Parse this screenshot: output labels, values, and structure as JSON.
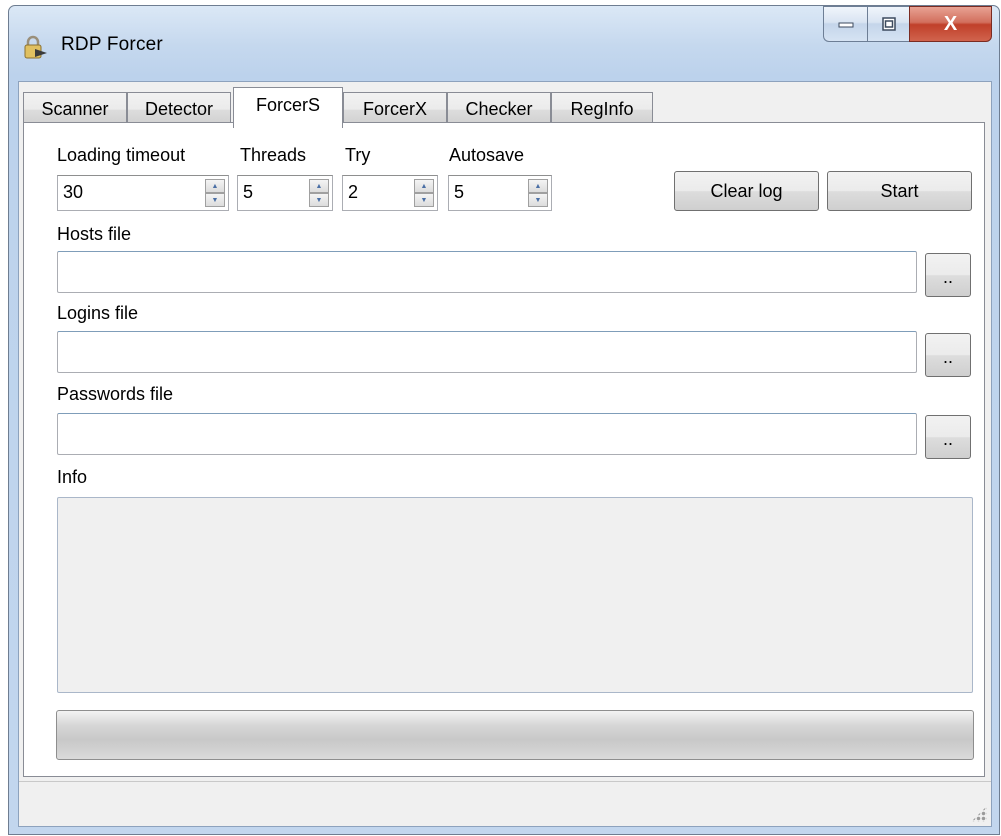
{
  "window": {
    "title": "RDP Forcer",
    "icon": "padlock-arrow-icon",
    "close_glyph": "X",
    "colors": {
      "close_red": "#c0402a",
      "frame_blue": "#c5d8ee"
    }
  },
  "tabs": [
    {
      "label": "Scanner",
      "active": false
    },
    {
      "label": "Detector",
      "active": false
    },
    {
      "label": "ForcerS",
      "active": true
    },
    {
      "label": "ForcerX",
      "active": false
    },
    {
      "label": "Checker",
      "active": false
    },
    {
      "label": "RegInfo",
      "active": false
    }
  ],
  "forcers": {
    "loading_timeout": {
      "label": "Loading timeout",
      "value": "30"
    },
    "threads": {
      "label": "Threads",
      "value": "5"
    },
    "try": {
      "label": "Try",
      "value": "2"
    },
    "autosave": {
      "label": "Autosave",
      "value": "5"
    },
    "clear_log_label": "Clear log",
    "start_label": "Start",
    "hosts_file": {
      "label": "Hosts file",
      "value": "",
      "browse_label": ".."
    },
    "logins_file": {
      "label": "Logins file",
      "value": "",
      "browse_label": ".."
    },
    "passwords_file": {
      "label": "Passwords file",
      "value": "",
      "browse_label": ".."
    },
    "info": {
      "label": "Info",
      "value": ""
    },
    "progress": 0
  },
  "status_text": ""
}
